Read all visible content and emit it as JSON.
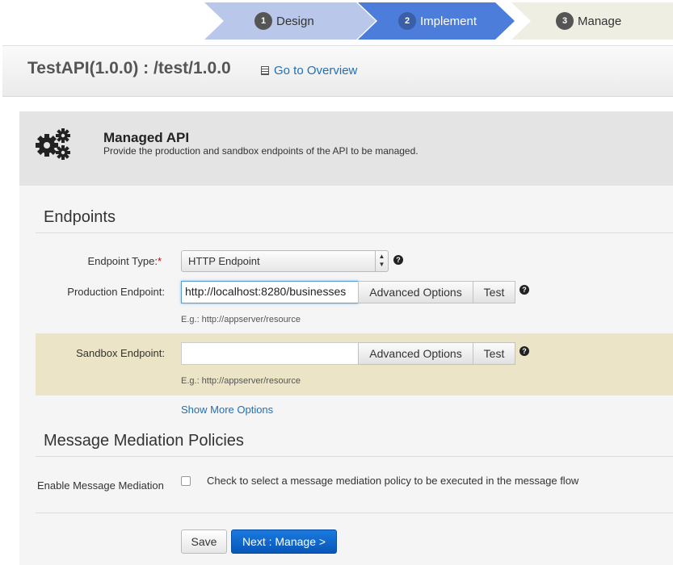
{
  "wizard": {
    "steps": [
      {
        "num": "1",
        "label": "Design"
      },
      {
        "num": "2",
        "label": "Implement"
      },
      {
        "num": "3",
        "label": "Manage"
      }
    ]
  },
  "header": {
    "api_title": "TestAPI(1.0.0) : /test/1.0.0",
    "overview_link": "Go to Overview"
  },
  "managed_api": {
    "title": "Managed API",
    "description": "Provide the production and sandbox endpoints of the API to be managed."
  },
  "endpoints": {
    "section_title": "Endpoints",
    "type_label": "Endpoint Type:",
    "required_mark": "*",
    "type_value": "HTTP Endpoint",
    "production_label": "Production Endpoint:",
    "production_value": "http://localhost:8280/businesses",
    "sandbox_label": "Sandbox Endpoint:",
    "sandbox_value": "",
    "advanced_options": "Advanced Options",
    "test": "Test",
    "hint": "E.g.: http://appserver/resource",
    "show_more": "Show More Options"
  },
  "mediation": {
    "section_title": "Message Mediation Policies",
    "enable_label": "Enable Message Mediation",
    "checkbox_text": "Check to select a message mediation policy to be executed in the message flow"
  },
  "actions": {
    "save": "Save",
    "next": "Next : Manage >"
  },
  "colors": {
    "accent": "#4c7ddb",
    "link": "#1f6fb4",
    "primary_button": "#0857b8",
    "sandbox_row": "#ece4c6"
  }
}
